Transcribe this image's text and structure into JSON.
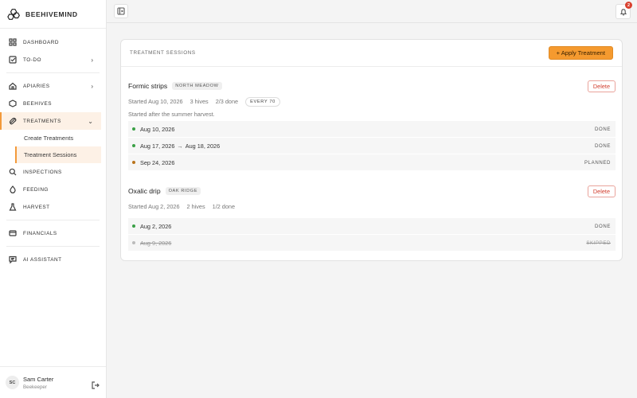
{
  "brand": {
    "name": "BEEHIVEMIND",
    "icon": "hive-logo-icon"
  },
  "sidebar": {
    "items": [
      {
        "label": "DASHBOARD",
        "icon": "grid-icon"
      },
      {
        "label": "TO-DO",
        "icon": "checkbox-icon"
      },
      {
        "label": "APIARIES",
        "icon": "house-icon"
      },
      {
        "label": "BEEHIVES",
        "icon": "hexagon-icon"
      },
      {
        "label": "TREATMENTS",
        "icon": "pill-icon"
      },
      {
        "label": "INSPECTIONS",
        "icon": "search-icon"
      },
      {
        "label": "FEEDING",
        "icon": "drop-icon"
      },
      {
        "label": "HARVEST",
        "icon": "flask-icon"
      },
      {
        "label": "FINANCIALS",
        "icon": "card-icon"
      },
      {
        "label": "AI ASSISTANT",
        "icon": "chat-icon"
      }
    ],
    "sub_items": [
      {
        "label": "Create Treatments"
      },
      {
        "label": "Treatment Sessions"
      }
    ]
  },
  "user": {
    "initials": "SC",
    "name": "Sam Carter",
    "role": "Beekeeper"
  },
  "topbar": {
    "notification_count": "2"
  },
  "card": {
    "title": "TREATMENT SESSIONS",
    "apply_label": "+ Apply Treatment"
  },
  "sessions": [
    {
      "name": "Formic strips",
      "location": "NORTH MEADOW",
      "delete_label": "Delete",
      "started": "Started Aug 10, 2026",
      "hives": "3 hives",
      "progress": "2/3 done",
      "frequency": "EVERY 70",
      "note": "Started after the summer harvest.",
      "rows": [
        {
          "date": "Aug 10, 2026",
          "end": "",
          "status": "DONE",
          "color": "#3aa046"
        },
        {
          "date": "Aug 17, 2026",
          "end": "Aug 18, 2026",
          "status": "DONE",
          "color": "#3aa046"
        },
        {
          "date": "Sep 24, 2026",
          "end": "",
          "status": "PLANNED",
          "color": "#b9741d"
        }
      ]
    },
    {
      "name": "Oxalic drip",
      "location": "OAK RIDGE",
      "delete_label": "Delete",
      "started": "Started Aug 2, 2026",
      "hives": "2 hives",
      "progress": "1/2 done",
      "rows": [
        {
          "date": "Aug 2, 2026",
          "status": "DONE",
          "color": "#3aa046"
        },
        {
          "date": "Aug 9, 2026",
          "status": "SKIPPED",
          "color": "#bbbbbb"
        }
      ]
    }
  ]
}
